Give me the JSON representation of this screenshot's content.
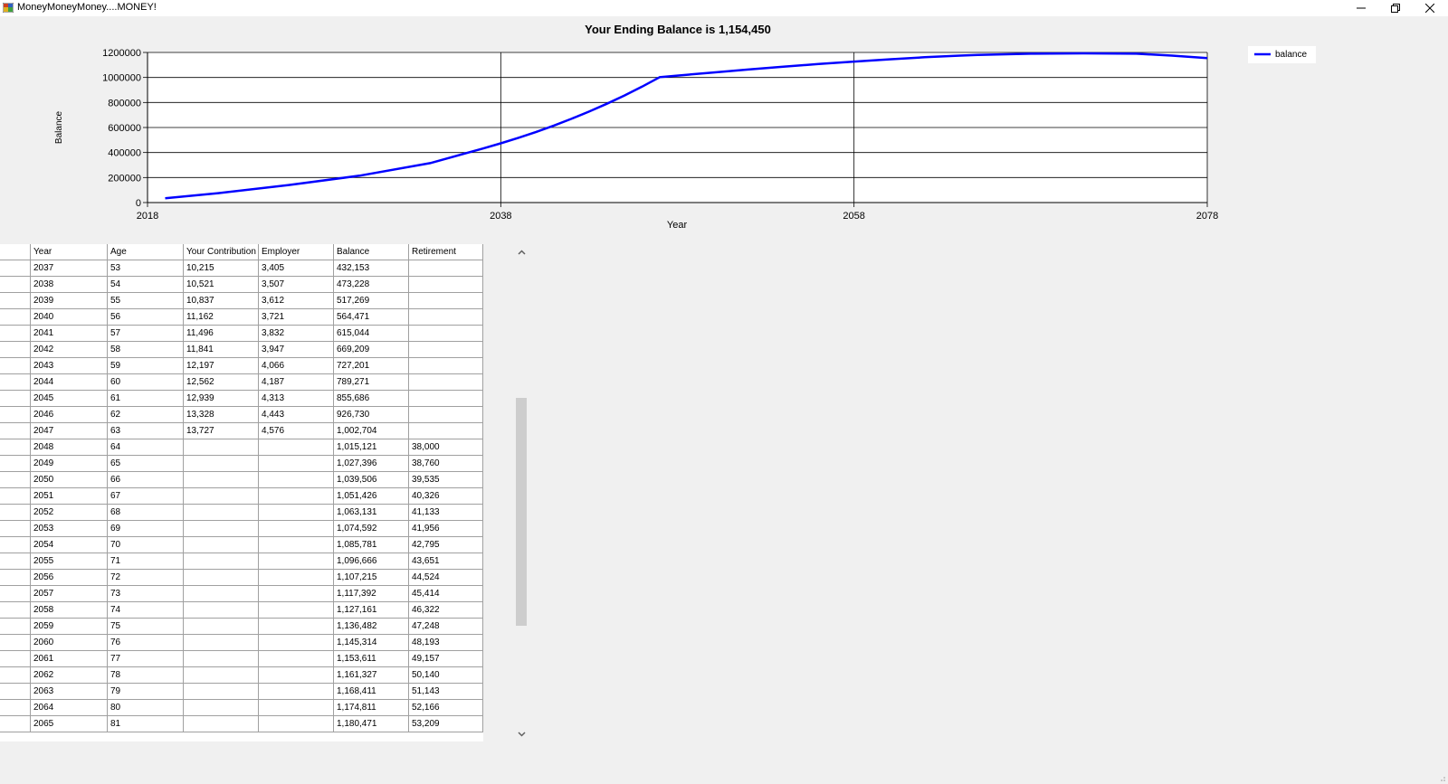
{
  "window": {
    "title": "MoneyMoneyMoney....MONEY!",
    "icon": "app-icon",
    "controls": [
      "minimize-icon",
      "restore-icon",
      "close-icon"
    ]
  },
  "chart_data": {
    "type": "line",
    "title": "Your Ending Balance is 1,154,450",
    "xlabel": "Year",
    "ylabel": "Balance",
    "x_ticks": [
      "2018",
      "2038",
      "2058",
      "2078"
    ],
    "y_ticks": [
      "0",
      "200000",
      "400000",
      "600000",
      "800000",
      "1000000",
      "1200000"
    ],
    "xlim": [
      2018,
      2078
    ],
    "ylim": [
      0,
      1200000
    ],
    "grid": true,
    "legend": "top-right",
    "series": [
      {
        "name": "balance",
        "color": "#0000ff",
        "x": [
          2019,
          2022,
          2026,
          2030,
          2034,
          2037,
          2038,
          2039,
          2040,
          2041,
          2042,
          2043,
          2044,
          2045,
          2046,
          2047,
          2048,
          2050,
          2052,
          2054,
          2056,
          2058,
          2060,
          2062,
          2064,
          2065,
          2068,
          2071,
          2074,
          2076,
          2078
        ],
        "y": [
          35000,
          75000,
          140000,
          215000,
          315000,
          432153,
          473228,
          517269,
          564471,
          615044,
          669209,
          727201,
          789271,
          855686,
          926730,
          1002704,
          1015121,
          1039506,
          1063131,
          1085781,
          1107215,
          1127161,
          1145314,
          1161327,
          1174811,
          1180471,
          1190000,
          1193000,
          1190000,
          1175000,
          1154450
        ]
      }
    ]
  },
  "table": {
    "columns": [
      "Year",
      "Age",
      "Your Contribution",
      "Employer",
      "Balance",
      "Retirement"
    ],
    "rows": [
      [
        "2037",
        "53",
        "10,215",
        "3,405",
        "432,153",
        ""
      ],
      [
        "2038",
        "54",
        "10,521",
        "3,507",
        "473,228",
        ""
      ],
      [
        "2039",
        "55",
        "10,837",
        "3,612",
        "517,269",
        ""
      ],
      [
        "2040",
        "56",
        "11,162",
        "3,721",
        "564,471",
        ""
      ],
      [
        "2041",
        "57",
        "11,496",
        "3,832",
        "615,044",
        ""
      ],
      [
        "2042",
        "58",
        "11,841",
        "3,947",
        "669,209",
        ""
      ],
      [
        "2043",
        "59",
        "12,197",
        "4,066",
        "727,201",
        ""
      ],
      [
        "2044",
        "60",
        "12,562",
        "4,187",
        "789,271",
        ""
      ],
      [
        "2045",
        "61",
        "12,939",
        "4,313",
        "855,686",
        ""
      ],
      [
        "2046",
        "62",
        "13,328",
        "4,443",
        "926,730",
        ""
      ],
      [
        "2047",
        "63",
        "13,727",
        "4,576",
        "1,002,704",
        ""
      ],
      [
        "2048",
        "64",
        "",
        "",
        "1,015,121",
        "38,000"
      ],
      [
        "2049",
        "65",
        "",
        "",
        "1,027,396",
        "38,760"
      ],
      [
        "2050",
        "66",
        "",
        "",
        "1,039,506",
        "39,535"
      ],
      [
        "2051",
        "67",
        "",
        "",
        "1,051,426",
        "40,326"
      ],
      [
        "2052",
        "68",
        "",
        "",
        "1,063,131",
        "41,133"
      ],
      [
        "2053",
        "69",
        "",
        "",
        "1,074,592",
        "41,956"
      ],
      [
        "2054",
        "70",
        "",
        "",
        "1,085,781",
        "42,795"
      ],
      [
        "2055",
        "71",
        "",
        "",
        "1,096,666",
        "43,651"
      ],
      [
        "2056",
        "72",
        "",
        "",
        "1,107,215",
        "44,524"
      ],
      [
        "2057",
        "73",
        "",
        "",
        "1,117,392",
        "45,414"
      ],
      [
        "2058",
        "74",
        "",
        "",
        "1,127,161",
        "46,322"
      ],
      [
        "2059",
        "75",
        "",
        "",
        "1,136,482",
        "47,248"
      ],
      [
        "2060",
        "76",
        "",
        "",
        "1,145,314",
        "48,193"
      ],
      [
        "2061",
        "77",
        "",
        "",
        "1,153,611",
        "49,157"
      ],
      [
        "2062",
        "78",
        "",
        "",
        "1,161,327",
        "50,140"
      ],
      [
        "2063",
        "79",
        "",
        "",
        "1,168,411",
        "51,143"
      ],
      [
        "2064",
        "80",
        "",
        "",
        "1,174,811",
        "52,166"
      ],
      [
        "2065",
        "81",
        "",
        "",
        "1,180,471",
        "53,209"
      ]
    ]
  }
}
